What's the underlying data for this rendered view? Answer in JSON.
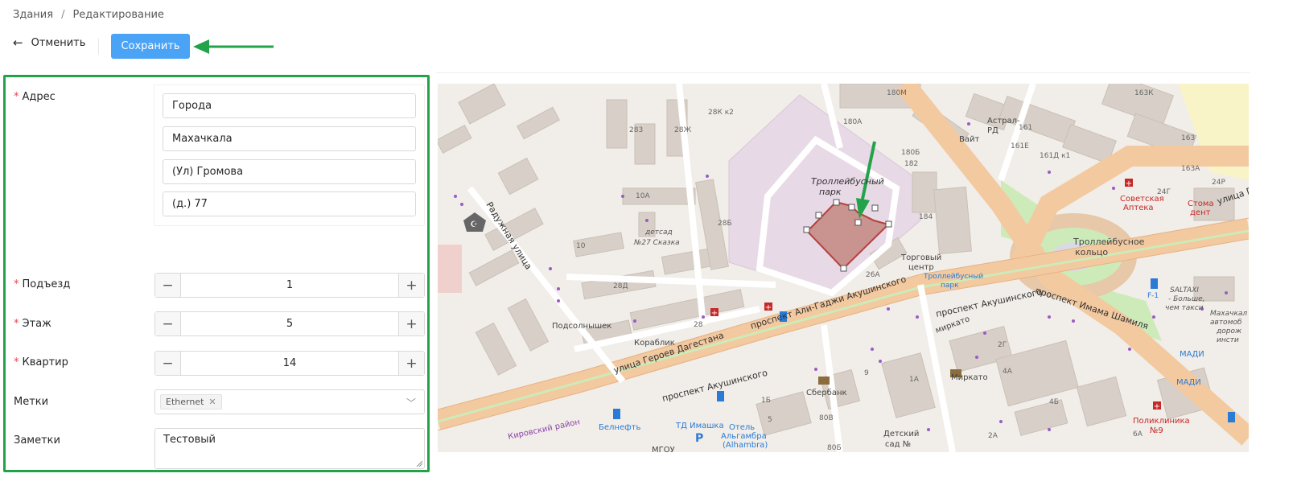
{
  "breadcrumb": {
    "root": "Здания",
    "separator": "/",
    "current": "Редактирование"
  },
  "toolbar": {
    "cancel_label": "Отменить",
    "save_label": "Сохранить"
  },
  "form": {
    "address": {
      "label": "Адрес",
      "fields": [
        "Города",
        "Махачкала",
        "(Ул) Громова",
        "(д.) 77"
      ]
    },
    "entrance": {
      "label": "Подъезд",
      "value": "1"
    },
    "floor": {
      "label": "Этаж",
      "value": "5"
    },
    "apartment": {
      "label": "Квартир",
      "value": "14"
    },
    "tags": {
      "label": "Метки",
      "items": [
        "Ethernet"
      ]
    },
    "notes": {
      "label": "Заметки",
      "value": "Тестовый"
    }
  },
  "map": {
    "labels": {
      "trolley_park": "Троллейбусный",
      "trolley_park2": "парк",
      "trolley_ring": "Троллейбусное",
      "trolley_ring2": "кольцо",
      "radujnaya": "Радужная улица",
      "heroes": "улица Героев Дагестана",
      "ali_gadzhi": "проспект Али-Гаджи Акушинского",
      "akushinsky1": "проспект Акушинского",
      "akushinsky2": "проспект Акушинского",
      "imam": "проспект Имама Шамиля",
      "ulitsa_g": "улица Г",
      "kirovsky": "Кировский район",
      "kindergarten": "детсад",
      "kindergarten2": "№27 Сказка",
      "podsolnyshek": "Подсолнышек",
      "korablik": "Кораблик",
      "shopping": "Торговый",
      "shopping2": "центр",
      "trolley_stop": "Троллейбусный",
      "trolley_stop2": "парк",
      "mirkato": "Миркато",
      "mirkato2": "миркато",
      "sberbank": "Сбербанк",
      "belneft": "Белнефть",
      "td_imashka": "ТД Имашка",
      "hotel": "Отель",
      "hotel2": "Альгамбра",
      "hotel3": "(Alhambra)",
      "polyclinic": "Поликлиника",
      "polyclinic2": "№9",
      "pharmacy": "Советская",
      "pharmacy2": "Аптека",
      "stoma": "Стома",
      "stoma2": "дент",
      "vait": "Вайт",
      "astral": "Астрал-",
      "astral2": "РД",
      "madi": "МАДИ",
      "saltaxi": "SALTAXI",
      "saltaxi2": "- Больше,",
      "saltaxi3": "чем такси",
      "school": "Махачкал",
      "school2": "автомоб",
      "school3": "дорож",
      "school4": "инсти",
      "kindergarten3": "Детский",
      "kindergarten4": "сад №",
      "mgou": "МГОУ",
      "f1": "F-1",
      "b_283": "283",
      "b_28zh": "28Ж",
      "b_28k2": "28К к2",
      "b_180m": "180М",
      "b_180a": "180А",
      "b_180b": "180Б",
      "b_182": "182",
      "b_161": "161",
      "b_161e": "161Е",
      "b_161d": "161Д к1",
      "b_163": "163",
      "b_163k": "163К",
      "b_163a": "163А",
      "b_24g": "24Г",
      "b_24p": "24Р",
      "b_10a": "10А",
      "b_10": "10",
      "b_28b": "28Б",
      "b_28d": "28Д",
      "b_28": "28",
      "b_184": "184",
      "b_26a": "26А",
      "b_2g": "2Г",
      "b_4a": "4А",
      "b_4b": "4Б",
      "b_1a": "1А",
      "b_9": "9",
      "b_1b": "1Б",
      "b_80v": "80В",
      "b_80b": "80Б",
      "b_2a": "2А",
      "b_6a": "6А",
      "b_5": "5"
    }
  }
}
